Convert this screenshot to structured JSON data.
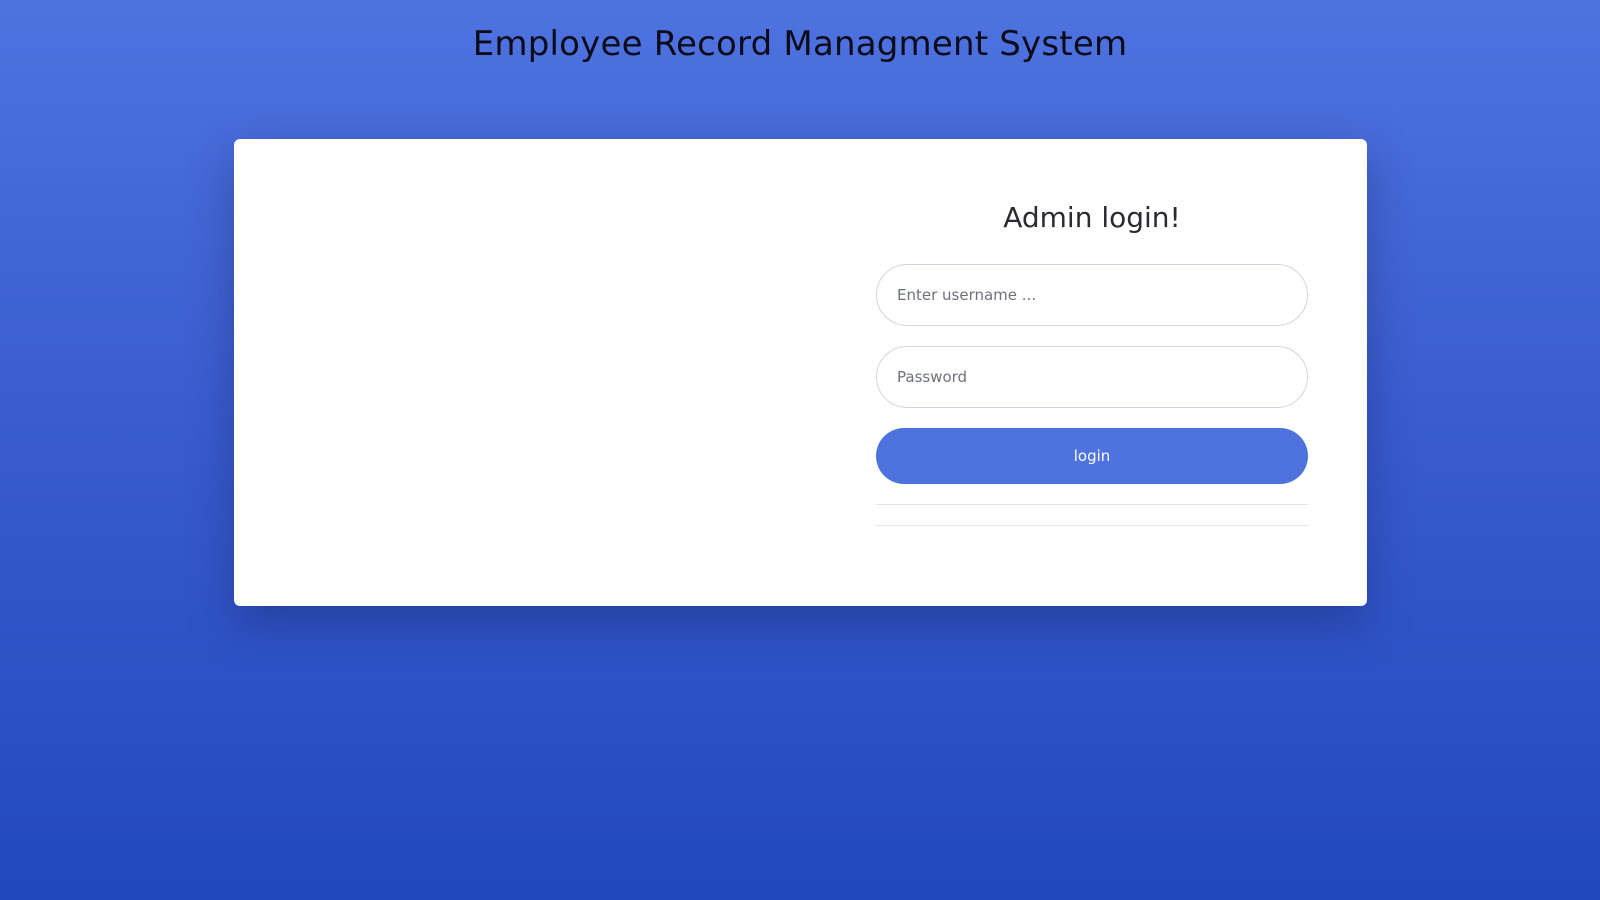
{
  "page": {
    "title": "Employee Record Managment System"
  },
  "login": {
    "heading": "Admin login!",
    "username_placeholder": "Enter username ...",
    "password_placeholder": "Password",
    "button_label": "login"
  },
  "colors": {
    "accent": "#4e73df",
    "background_top": "#4e73df",
    "background_bottom": "#2248be",
    "card": "#ffffff"
  }
}
